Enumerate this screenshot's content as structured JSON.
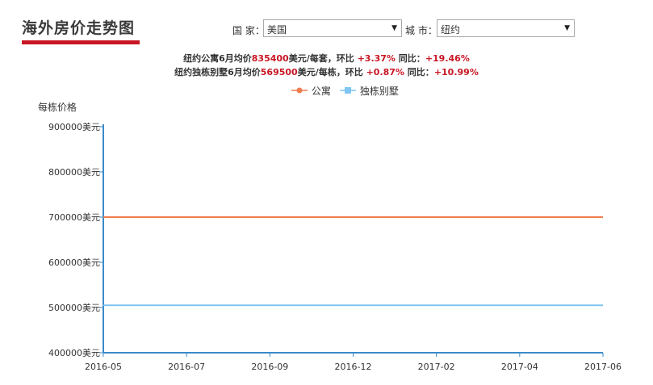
{
  "header": {
    "title": "海外房价走势图"
  },
  "filters": {
    "country_label": "国 家：",
    "country_value": "美国",
    "city_label": "城 市：",
    "city_value": "纽约"
  },
  "summary": {
    "line1": {
      "pre": "纽约公寓6月均价",
      "price": "835400",
      "unit": "美元/每套，环比 ",
      "mom": "+3.37%",
      "mid": " 同比：",
      "yoy": "+19.46%"
    },
    "line2": {
      "pre": "纽约独栋别墅6月均价",
      "price": "569500",
      "unit": "美元/每栋，环比 ",
      "mom": "+0.87%",
      "mid": " 同比：",
      "yoy": "+10.99%"
    }
  },
  "colors": {
    "apartment": "#f07d4f",
    "villa": "#7ec5f2",
    "axis": "#3a8ac8",
    "accent": "#c81623"
  },
  "chart_data": {
    "type": "line",
    "ylabel": "每栋价格",
    "ylim": [
      400000,
      900000
    ],
    "yticks": [
      900000,
      800000,
      700000,
      600000,
      500000,
      400000
    ],
    "ytick_labels": [
      "900000美元",
      "800000美元",
      "700000美元",
      "600000美元",
      "500000美元",
      "400000美元"
    ],
    "x": [
      "2016-05",
      "2016-07",
      "2016-09",
      "2016-12",
      "2017-02",
      "2017-04",
      "2017-06"
    ],
    "legend_position": "top-center",
    "grid": false,
    "series": [
      {
        "name": "公寓",
        "marker": "circle",
        "values": [
          700000,
          700000,
          700000,
          700000,
          700000,
          700000,
          700000
        ]
      },
      {
        "name": "独栋别墅",
        "marker": "square",
        "values": [
          505000,
          505000,
          505000,
          505000,
          505000,
          505000,
          505000
        ]
      }
    ]
  }
}
